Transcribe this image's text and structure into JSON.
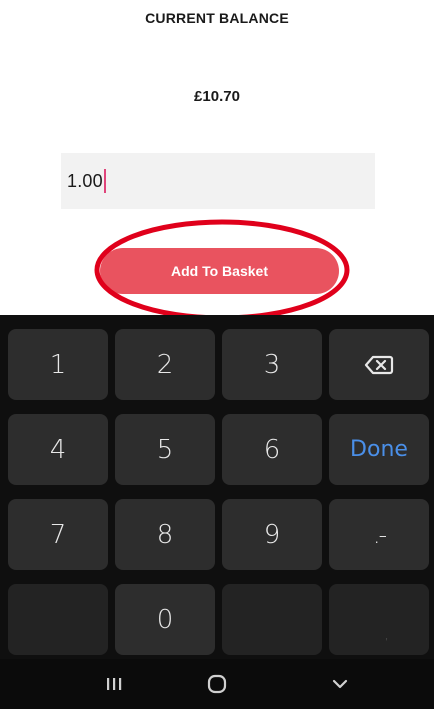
{
  "balance": {
    "label": "CURRENT BALANCE",
    "value": "£10.70"
  },
  "amount_input": {
    "value": "1.00"
  },
  "add_button": {
    "label": "Add To Basket"
  },
  "keyboard": {
    "keys": [
      "1",
      "2",
      "3",
      "backspace-icon",
      "4",
      "5",
      "6",
      "Done",
      "7",
      "8",
      "9",
      ".-",
      "",
      "0",
      "",
      ","
    ],
    "done_color": "#4a8fe8"
  },
  "navbar": {
    "items": [
      "recent-apps-icon",
      "home-icon",
      "back-chevron-icon"
    ]
  },
  "colors": {
    "accent": "#e9535f",
    "highlight_ring": "#e0001b",
    "caret": "#e0457b",
    "keyboard_bg": "#0f0f0f",
    "key_bg": "#2d2d2d"
  }
}
